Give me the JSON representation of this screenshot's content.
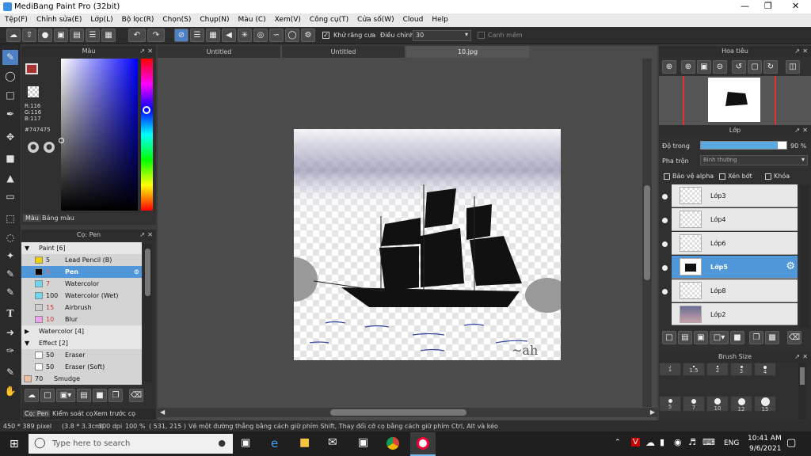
{
  "app": {
    "title": "MediBang Paint Pro (32bit)"
  },
  "menu": [
    "Tệp(F)",
    "Chỉnh sửa(E)",
    "Lớp(L)",
    "Bộ lọc(R)",
    "Chọn(S)",
    "Chụp(N)",
    "Màu (C)",
    "Xem(V)",
    "Công cụ(T)",
    "Cửa số(W)",
    "Cloud",
    "Help"
  ],
  "toolbar": {
    "antialias_label": "Khử răng cưa",
    "adjust_label": "Điều chỉnh",
    "adjust_value": "30",
    "snap_label": "Canh mềm"
  },
  "color_panel": {
    "title": "Màu",
    "r": "R:116",
    "g": "G:116",
    "b": "B:117",
    "hex": "#747475",
    "tab_color": "Màu",
    "tab_palette": "Bảng màu",
    "primary": "#a83232",
    "secondary": "#000000"
  },
  "brush_panel": {
    "title": "Cọ: Pen",
    "items": [
      {
        "group": true,
        "name": "Paint [6]",
        "open": true
      },
      {
        "color": "#f0d000",
        "size": "5",
        "name": "Lead Pencil (B)"
      },
      {
        "color": "#000000",
        "size": "3",
        "name": "Pen",
        "selected": true
      },
      {
        "color": "#6ad8f0",
        "size": "7",
        "name": "Watercolor"
      },
      {
        "color": "#6ad8f0",
        "size": "100",
        "name": "Watercolor (Wet)"
      },
      {
        "color": "#cccccc",
        "size": "15",
        "name": "Airbrush"
      },
      {
        "color": "#f0a0f0",
        "size": "10",
        "name": "Blur"
      },
      {
        "group": true,
        "name": "Watercolor [4]",
        "open": false
      },
      {
        "group": true,
        "name": "Effect [2]",
        "open": true
      },
      {
        "color": "#ffffff",
        "size": "50",
        "name": "Eraser"
      },
      {
        "color": "#ffffff",
        "size": "50",
        "name": "Eraser (Soft)"
      },
      {
        "color": "#f0c0a0",
        "size": "70",
        "name": "Smudge",
        "root": true
      }
    ],
    "tabs": [
      "Cọ: Pen",
      "Kiểm soát cọ",
      "Xem trước cọ"
    ]
  },
  "docs": [
    "Untitled",
    "Untitled",
    "10.jpg"
  ],
  "navigator": {
    "title": "Hoa tiêu"
  },
  "layer_panel": {
    "title": "Lớp",
    "opacity_label": "Độ trong",
    "opacity_value": "90 %",
    "opacity": 0.9,
    "blend_label": "Pha trộn",
    "blend_value": "Bình thường",
    "protect_alpha": "Bảo vệ alpha",
    "clipping": "Xén bớt",
    "lock": "Khóa",
    "layers": [
      "Lớp3",
      "Lớp4",
      "Lớp6",
      "Lớp5",
      "Lớp8",
      "Lớp2"
    ],
    "selected": "Lớp5"
  },
  "brush_size": {
    "title": "Brush Size",
    "sizes": [
      "1",
      "1.5",
      "2",
      "3",
      "4",
      "5",
      "7",
      "10",
      "12",
      "15"
    ]
  },
  "status": {
    "dims": "450 * 389 pixel",
    "cm": "(3.8 * 3.3cm)",
    "dpi": "300 dpi",
    "zoom": "100 %",
    "coords": "( 531, 215 )",
    "hint": "Vẽ một đường thẳng bằng cách giữ phím Shift, Thay đổi cỡ cọ bằng cách giữ phím Ctrl, Alt và kéo"
  },
  "taskbar": {
    "search": "Type here to search",
    "lang": "ENG",
    "time": "10:41 AM",
    "date": "9/6/2021"
  }
}
